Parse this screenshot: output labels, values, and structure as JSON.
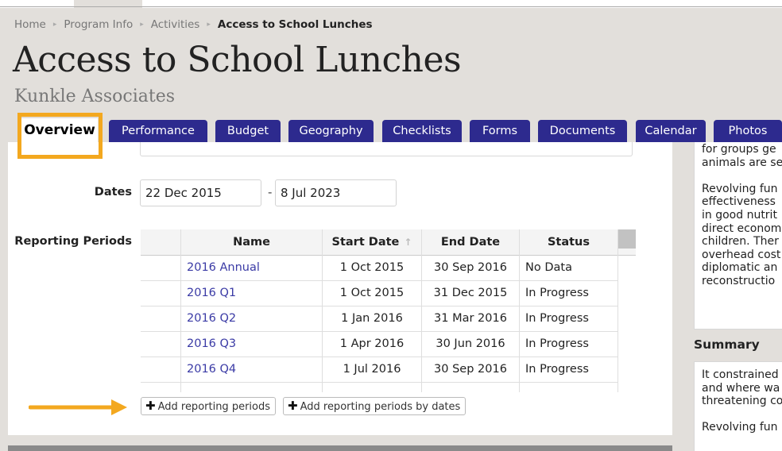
{
  "breadcrumb": {
    "home": "Home",
    "program_info": "Program Info",
    "activities": "Activities",
    "current": "Access to School Lunches",
    "separator": "▸"
  },
  "page": {
    "title": "Access to School Lunches",
    "subtitle": "Kunkle Associates"
  },
  "tabs": [
    {
      "label": "Overview",
      "active": true
    },
    {
      "label": "Performance"
    },
    {
      "label": "Budget"
    },
    {
      "label": "Geography"
    },
    {
      "label": "Checklists"
    },
    {
      "label": "Forms"
    },
    {
      "label": "Documents"
    },
    {
      "label": "Calendar"
    },
    {
      "label": "Photos"
    }
  ],
  "form": {
    "dates_label": "Dates",
    "start_date": "22 Dec 2015",
    "date_separator": "-",
    "end_date": "8 Jul 2023",
    "reporting_periods_label": "Reporting Periods"
  },
  "table": {
    "columns": [
      "Name",
      "Start Date",
      "End Date",
      "Status"
    ],
    "sort_icon": "↑",
    "rows": [
      {
        "name": "2016 Annual",
        "start": "1 Oct 2015",
        "end": "30 Sep 2016",
        "status": "No Data"
      },
      {
        "name": "2016 Q1",
        "start": "1 Oct 2015",
        "end": "31 Dec 2015",
        "status": "In Progress"
      },
      {
        "name": "2016 Q2",
        "start": "1 Jan 2016",
        "end": "31 Mar 2016",
        "status": "In Progress"
      },
      {
        "name": "2016 Q3",
        "start": "1 Apr 2016",
        "end": "30 Jun 2016",
        "status": "In Progress"
      },
      {
        "name": "2016 Q4",
        "start": "1 Jul 2016",
        "end": "30 Sep 2016",
        "status": "In Progress"
      }
    ]
  },
  "buttons": {
    "add_reporting_periods": "Add reporting periods",
    "add_reporting_periods_by_dates": "Add reporting periods by dates",
    "plus_glyph": "✚"
  },
  "sidebar": {
    "top_text_lines": [
      "for groups ge",
      "animals are se",
      "",
      "Revolving fun",
      "effectiveness",
      "in good nutrit",
      "direct econom",
      "children. Ther",
      "overhead cost",
      "diplomatic an",
      "reconstructio"
    ],
    "summary_heading": "Summary",
    "summary_lines": [
      "It constrained",
      "and where wa",
      "threatening co",
      "",
      "Revolving fun"
    ]
  },
  "colors": {
    "tab_bg": "#2d2a8e",
    "highlight": "#f3a81f",
    "link": "#3a3aa5",
    "page_bg": "#e2dfdb"
  }
}
